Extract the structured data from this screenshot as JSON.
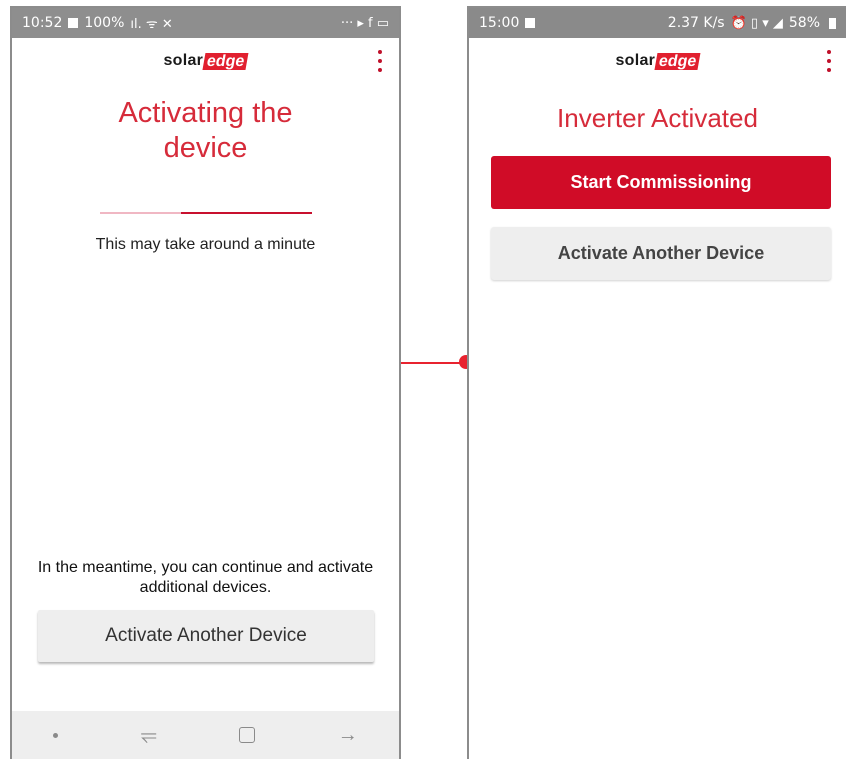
{
  "left_phone": {
    "status": {
      "time": "10:52",
      "battery": "100%",
      "indicators": "ıl. ᯤ ✕",
      "right_icons": "··· ▸ f ▭"
    },
    "logo": {
      "solar": "solar",
      "edge": "edge"
    },
    "title": "Activating the device",
    "progress": {
      "fill_start_fraction": 0.38,
      "fill_end_fraction": 1.0
    },
    "wait_text": "This may take around a minute",
    "meantime_text": "In the meantime, you can continue and activate additional devices.",
    "activate_button_label": "Activate Another Device",
    "nav_icons": [
      "dot",
      "recent-apps-icon",
      "home-icon",
      "back-icon"
    ]
  },
  "right_phone": {
    "status": {
      "time": "15:00",
      "speed": "2.37 K/s",
      "right_icons": "⏰ ▯ ▾ ◢",
      "battery": "58%"
    },
    "logo": {
      "solar": "solar",
      "edge": "edge"
    },
    "title": "Inverter Activated",
    "start_button_label": "Start Commissioning",
    "activate_button_label": "Activate Another Device"
  },
  "colors": {
    "brand_red": "#d00c27",
    "title_red": "#d62b3a",
    "connector_red": "#e8232f",
    "progress_track": "#f0b7c3",
    "status_bar": "#8e8e8e"
  }
}
